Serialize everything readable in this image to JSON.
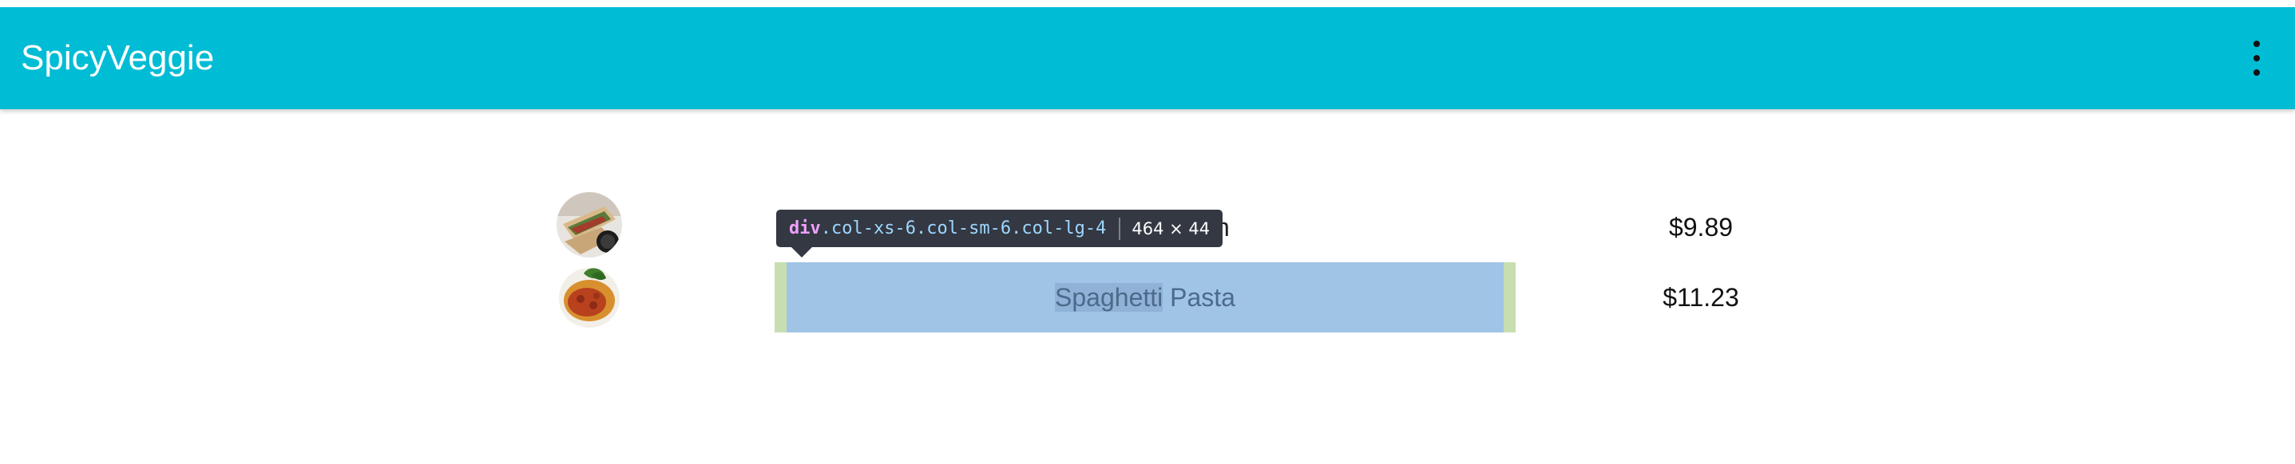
{
  "app": {
    "title": "SpicyVeggie",
    "menu_icon": "more-vert-icon",
    "bar_color": "#00bcd4"
  },
  "menu_items": [
    {
      "name_visible_fragment": "ch",
      "price": "$9.89",
      "thumbnail": "sandwich-photo"
    },
    {
      "name_highlighted": "Spaghetti",
      "name_rest": " Pasta",
      "price": "$11.23",
      "thumbnail": "spaghetti-photo"
    }
  ],
  "devtools_tooltip": {
    "tag": "div",
    "classes": ".col-xs-6.col-sm-6.col-lg-4",
    "size": "464 × 44",
    "content_color": "#9fc4e6",
    "padding_color": "#c7dfb0"
  }
}
